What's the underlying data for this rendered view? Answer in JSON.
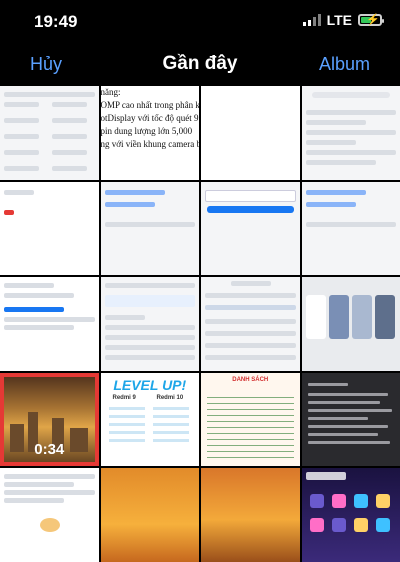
{
  "status_bar": {
    "time": "19:49",
    "network": "LTE"
  },
  "nav": {
    "cancel": "Hủy",
    "title": "Gần đây",
    "album": "Album"
  },
  "grid": {
    "doc_lines": [
      "năng:",
      "OMP cao nhất trong phân k",
      "otDisplay với tốc độ quét 9",
      "pin dung lượng lớn 5,000",
      "",
      "ng với viền khung camera b"
    ],
    "video_duration": "0:34",
    "levelup": {
      "title": "LEVEL UP!",
      "col1": "Redmi 9",
      "col2": "Redmi 10"
    },
    "table_header": "DANH SÁCH"
  },
  "colors": {
    "accent": "#5aa0ff",
    "battery": "#34c759",
    "highlight": "#e53935"
  }
}
